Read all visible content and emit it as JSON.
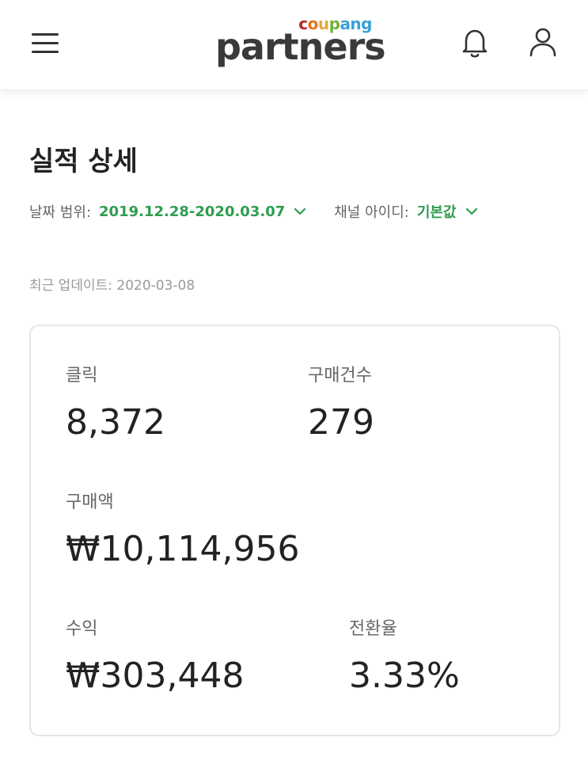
{
  "header": {
    "logo_top": "coupang",
    "logo_main": "partners"
  },
  "page": {
    "title": "실적 상세",
    "date_range_label": "날짜 범위:",
    "date_range_value": "2019.12.28-2020.03.07",
    "channel_label": "채널 아이디:",
    "channel_value": "기본값",
    "last_updated": "최근 업데이트: 2020-03-08"
  },
  "stats": {
    "clicks_label": "클릭",
    "clicks_value": "8,372",
    "orders_label": "구매건수",
    "orders_value": "279",
    "sales_label": "구매액",
    "sales_value": "₩10,114,956",
    "revenue_label": "수익",
    "revenue_value": "₩303,448",
    "conversion_label": "전환율",
    "conversion_value": "3.33%"
  },
  "colors": {
    "accent_green": "#2e9d4f",
    "text_dark": "#222222",
    "text_muted": "#666666"
  },
  "icons": [
    "menu-icon",
    "bell-icon",
    "user-icon",
    "chevron-down-icon"
  ]
}
